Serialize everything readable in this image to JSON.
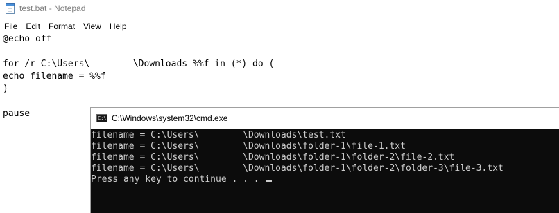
{
  "notepad": {
    "title": "test.bat - Notepad",
    "menu": [
      "File",
      "Edit",
      "Format",
      "View",
      "Help"
    ],
    "lines": [
      "@echo off",
      "",
      "for /r C:\\Users\\        \\Downloads %%f in (*) do (",
      "echo filename = %%f",
      ")",
      "",
      "pause"
    ]
  },
  "cmd": {
    "icon_text": "C:\\",
    "title": "C:\\Windows\\system32\\cmd.exe",
    "lines": [
      "filename = C:\\Users\\        \\Downloads\\test.txt",
      "filename = C:\\Users\\        \\Downloads\\folder-1\\file-1.txt",
      "filename = C:\\Users\\        \\Downloads\\folder-1\\folder-2\\file-2.txt",
      "filename = C:\\Users\\        \\Downloads\\folder-1\\folder-2\\folder-3\\file-3.txt",
      "Press any key to continue . . . "
    ]
  }
}
